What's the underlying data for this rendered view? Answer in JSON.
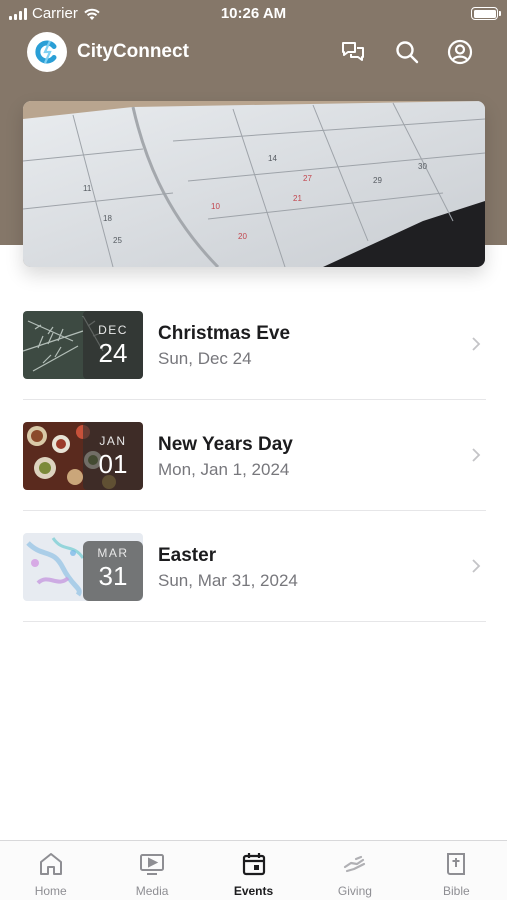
{
  "status_bar": {
    "carrier": "Carrier",
    "time": "10:26 AM"
  },
  "header": {
    "app_name": "CityConnect"
  },
  "hero": {
    "description_icon": "calendar-photo"
  },
  "events": [
    {
      "month": "DEC",
      "day": "24",
      "title": "Christmas Eve",
      "date": "Sun, Dec 24"
    },
    {
      "month": "JAN",
      "day": "01",
      "title": "New Years Day",
      "date": "Mon, Jan 1, 2024"
    },
    {
      "month": "MAR",
      "day": "31",
      "title": "Easter",
      "date": "Sun, Mar 31, 2024"
    }
  ],
  "tabs": [
    {
      "label": "Home",
      "icon": "home-icon"
    },
    {
      "label": "Media",
      "icon": "media-icon"
    },
    {
      "label": "Events",
      "icon": "events-icon"
    },
    {
      "label": "Giving",
      "icon": "giving-icon"
    },
    {
      "label": "Bible",
      "icon": "bible-icon"
    }
  ],
  "colors": {
    "header_bg": "#857769",
    "accent_logo": "#2a9fd6",
    "active_tab": "#1c1c1e",
    "inactive_tab": "#8e8e93"
  }
}
